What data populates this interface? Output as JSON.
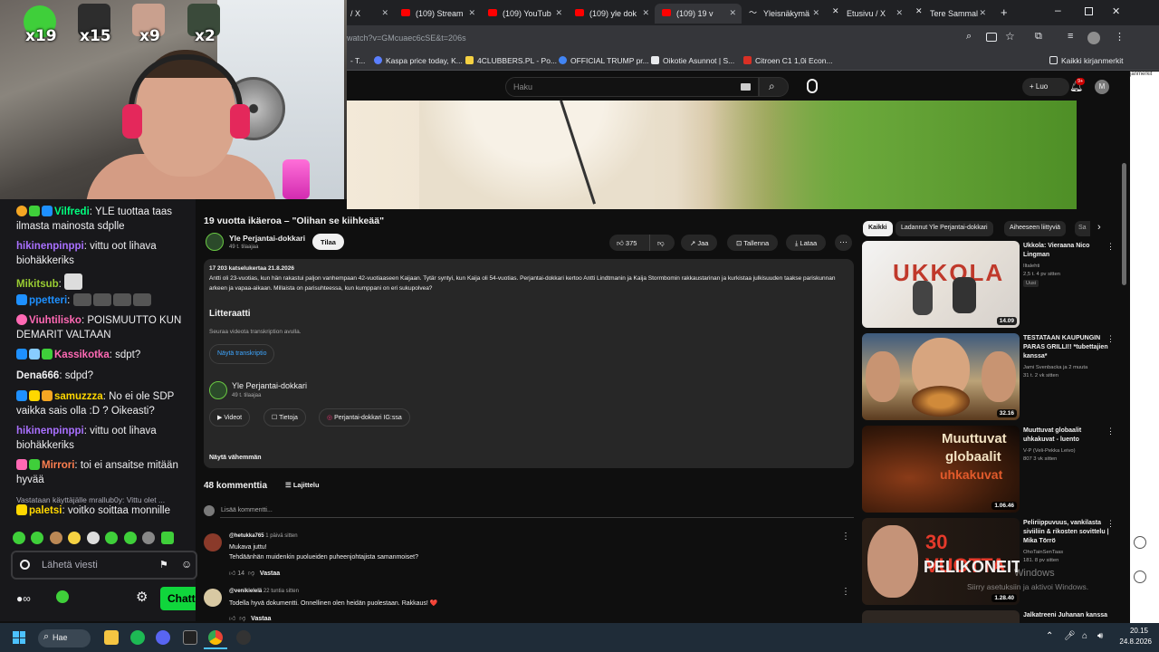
{
  "webcam": {
    "emote_counts": [
      "x19",
      "x15",
      "x9",
      "x2"
    ]
  },
  "chat": {
    "messages": [
      {
        "user": "Vilfredi",
        "text": "YLE tuottaa taas ilmasta mainosta sdplle",
        "color": "#00ff7f"
      },
      {
        "user": "hikinenpinppi",
        "text": "vittu oot lihava biohäkkeriks",
        "color": "#a970ff"
      },
      {
        "user": "Mikitsub",
        "text": "",
        "color": "#9acd32"
      },
      {
        "user": "ppetteri",
        "text": "",
        "color": "#1e90ff"
      },
      {
        "user": "Viuhtilisko",
        "text": "POISMUUTTO KUN DEMARIT VALTAAN",
        "color": "#ff69b4"
      },
      {
        "user": "Kassikotka",
        "text": "sdpt?",
        "color": "#ff69b4"
      },
      {
        "user": "Dena666",
        "text": "sdpd?",
        "color": "#efeff1"
      },
      {
        "user": "samuzzza",
        "text": "No ei ole SDP vaikka sais olla :D ? Oikeasti?",
        "color": "#ffd700"
      },
      {
        "user": "hikinenpinppi",
        "text": "vittu oot lihava biohäkkeriks",
        "color": "#a970ff"
      },
      {
        "user": "Mirrori",
        "text": "toi ei ansaitse mitään hyvää",
        "color": "#ff7f50"
      },
      {
        "user": "paletsi",
        "text": "voitko soittaa monnille",
        "color": "#ffd700"
      }
    ],
    "reply_preview": "Vastataan käyttäjälle mrallub0y: Vittu olet ...",
    "input_placeholder": "Lähetä viesti",
    "send_label": "Chatti"
  },
  "browser": {
    "tabs": [
      {
        "label": "/ X",
        "active": false
      },
      {
        "label": "(109) Stream",
        "active": false
      },
      {
        "label": "(109) YouTub",
        "active": false
      },
      {
        "label": "(109) yle dok",
        "active": false
      },
      {
        "label": "(109) 19 v",
        "active": true
      },
      {
        "label": "Yleisnäkymä",
        "active": false
      },
      {
        "label": "Etusivu / X",
        "active": false
      },
      {
        "label": "Tere Sammal",
        "active": false
      }
    ],
    "url": "watch?v=GMcuaec6cSE&t=206s",
    "bookmarks": [
      "- T...",
      "Kaspa price today, K...",
      "4CLUBBERS.PL - Po...",
      "OFFICIAL TRUMP pr...",
      "Oikotie Asunnot | S...",
      "Citroen C1 1,0i Econ..."
    ],
    "all_bookmarks": "Kaikki kirjanmerkit",
    "side_text": "janmerkit"
  },
  "youtube": {
    "search_placeholder": "Haku",
    "create_label": "Luo",
    "notif_count": "9+",
    "profile_initial": "M",
    "video_title": "19 vuotta ikäeroa – \"Olihan se kiihkeää\"",
    "channel": "Yle Perjantai-dokkari",
    "subscribers": "49 t. tilaajaa",
    "subscribe_label": "Tilaa",
    "likes": "375",
    "share_label": "Jaa",
    "save_label": "Tallenna",
    "download_label": "Lataa",
    "views_date": "17 203 katselukertaa  21.8.2026",
    "description": "Antti oli 23-vuotias, kun hän rakastui paljon vanhempaan 42-vuotiaaseen Kaijaan. Tytär syntyi, kun Kaija oli 54-vuotias. Perjantai-dokkari kertoo Antti Lindtmanin ja Kaija Stormbomin rakkaustarinan ja kurkistaa julkisuuden taakse pariskunnan arkeen ja vapaa-aikaan. Millaista on parisuhteessa, kun kumppani on eri sukupolvea?",
    "transcript_heading": "Litteraatti",
    "transcript_sub": "Seuraa videota transkription avulla.",
    "transcript_btn": "Näytä transkriptio",
    "channel2": "Yle Perjantai-dokkari",
    "subscribers2": "49 t. tilaajaa",
    "videos_btn": "Videot",
    "about_btn": "Tietoja",
    "ig_btn": "Perjantai-dokkari IG:ssa",
    "show_less": "Näytä vähemmän",
    "comment_count": "48 kommenttia",
    "sort_label": "Lajittelu",
    "add_comment": "Lisää kommentti...",
    "comments": [
      {
        "author": "@hetukka765",
        "time": "1 päivä sitten",
        "text1": "Mukava juttu!",
        "text2": "Tehdäänhän muidenkin puolueiden puheenjohtajista samanmoiset?",
        "likes": "14",
        "reply": "Vastaa"
      },
      {
        "author": "@venikielelä",
        "time": "22 tuntia sitten",
        "text1": "Todella hyvä dokumentti.  Onnellinen olen heidän puolestaan. Rakkaus! ❤️",
        "text2": "",
        "likes": "",
        "reply": "Vastaa"
      }
    ],
    "filter_chips": [
      "Kaikki",
      "Ladannut Yle Perjantai-dokkari",
      "Aiheeseen liittyviä",
      "Sa"
    ],
    "recommendations": [
      {
        "title": "Ukkola: Vieraana Nico Lingman",
        "channel": "Iltalehti",
        "meta": "2,5 t.  4 pv sitten",
        "badge": "Uusi",
        "duration": "14.09"
      },
      {
        "title": "TESTATAAN KAUPUNGIN PARAS GRILLI!! *tubettajien kanssa*",
        "channel": "Jami Svenbacka ja 2 muuta",
        "meta": "31 t.  2 vk sitten",
        "badge": "",
        "duration": "32.16"
      },
      {
        "title": "Muuttuvat globaalit uhkakuvat - luento",
        "channel": "V-P (Veli-Pekka Leivo)",
        "meta": "807  3 vk sitten",
        "badge": "",
        "duration": "1.06.46"
      },
      {
        "title": "Peliriippuvuus, vankilasta siviiliin & rikosten sovittelu | Mika Törrö",
        "channel": "OhoTainSenTaas",
        "meta": "181.  8 pv sitten",
        "badge": "",
        "duration": "1.28.40"
      },
      {
        "title": "Jalkatreeni Juhanan kanssa",
        "channel": "",
        "meta": "",
        "badge": "",
        "duration": ""
      }
    ],
    "thumb_text_1": "UKKOLA",
    "thumb_text_3a": "Muuttuvat",
    "thumb_text_3b": "globaalit",
    "thumb_text_3c": "uhkakuvat",
    "thumb_text_4a": "30 VUOTTA",
    "thumb_text_4b": "PELIKONEITA",
    "activate_windows_1": "Windows",
    "activate_windows_2": "Siirry asetuksiin ja aktivoi Windows."
  },
  "taskbar": {
    "search_label": "Hae",
    "time": "20.15",
    "date": "24.8.2026"
  }
}
